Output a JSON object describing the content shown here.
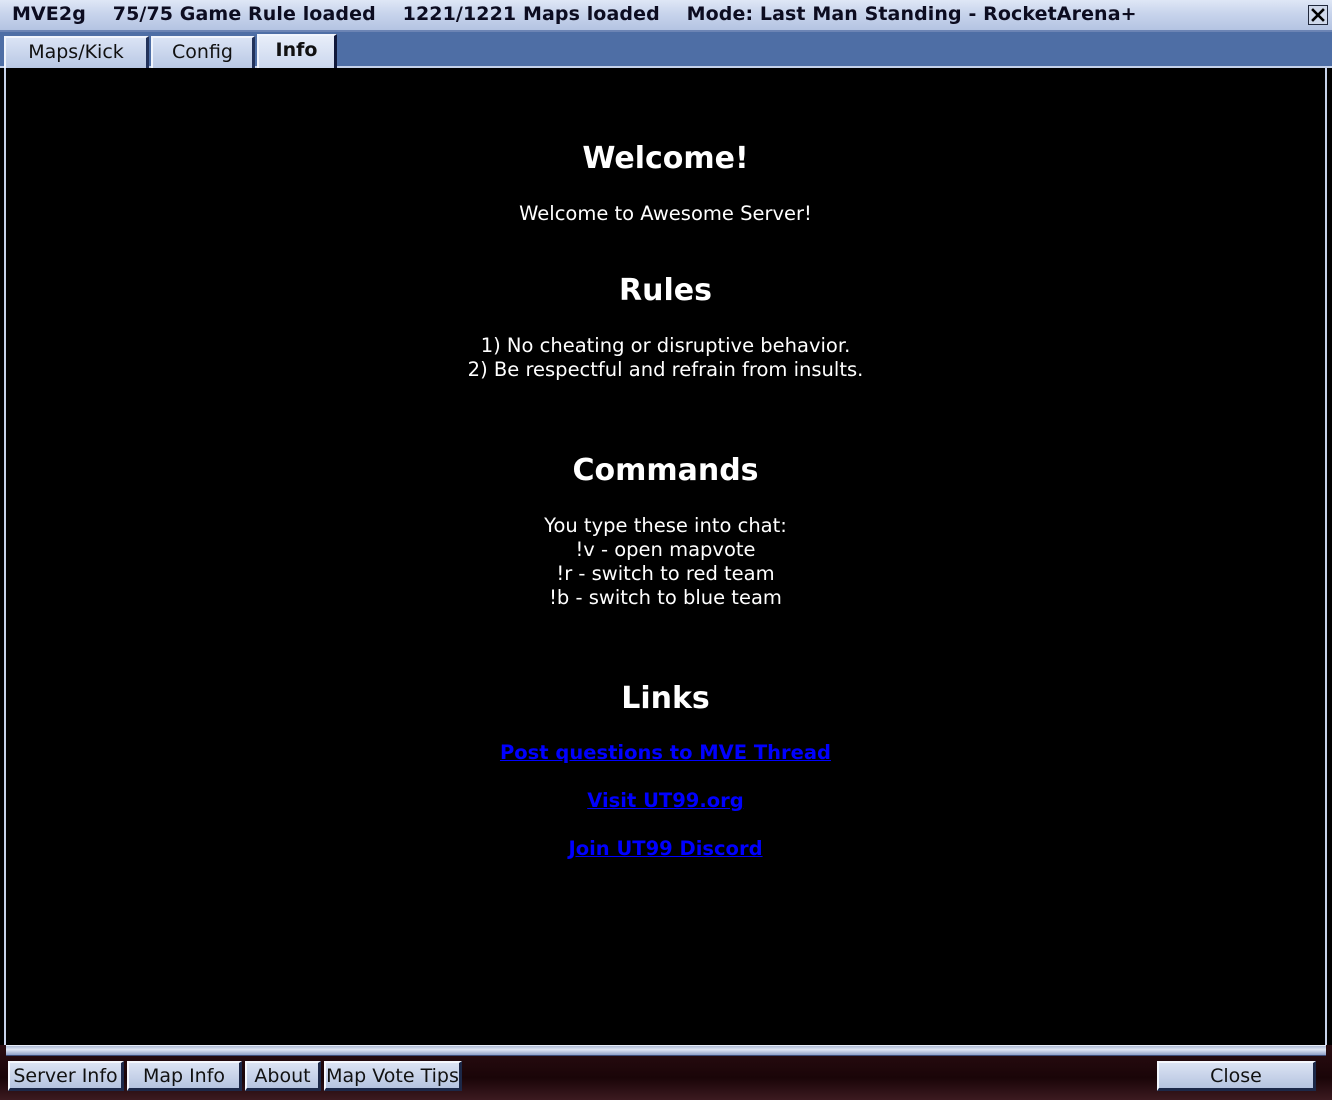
{
  "window": {
    "title": "MVE2g    75/75 Game Rule loaded    1221/1221 Maps loaded    Mode: Last Man Standing - RocketArena+"
  },
  "tabs": [
    {
      "label": "Maps/Kick",
      "active": false
    },
    {
      "label": "Config",
      "active": false
    },
    {
      "label": "Info",
      "active": true
    }
  ],
  "info": {
    "welcome_heading": "Welcome!",
    "welcome_text": "Welcome to Awesome Server!",
    "rules_heading": "Rules",
    "rules": [
      "1) No cheating or disruptive behavior.",
      "2) Be respectful and refrain from insults."
    ],
    "commands_heading": "Commands",
    "commands": [
      "You type these into chat:",
      "!v - open mapvote",
      "!r - switch to red team",
      "!b - switch to blue team"
    ],
    "links_heading": "Links",
    "links": [
      "Post questions to MVE Thread",
      "Visit UT99.org",
      "Join UT99 Discord"
    ]
  },
  "bottom_buttons": {
    "server_info": "Server Info",
    "map_info": "Map Info",
    "about": "About",
    "map_vote_tips": "Map Vote Tips",
    "close": "Close"
  },
  "colors": {
    "link": "#0000ff",
    "tab_strip": "#4e6ea5",
    "content_bg": "#000000",
    "text": "#ffffff"
  }
}
